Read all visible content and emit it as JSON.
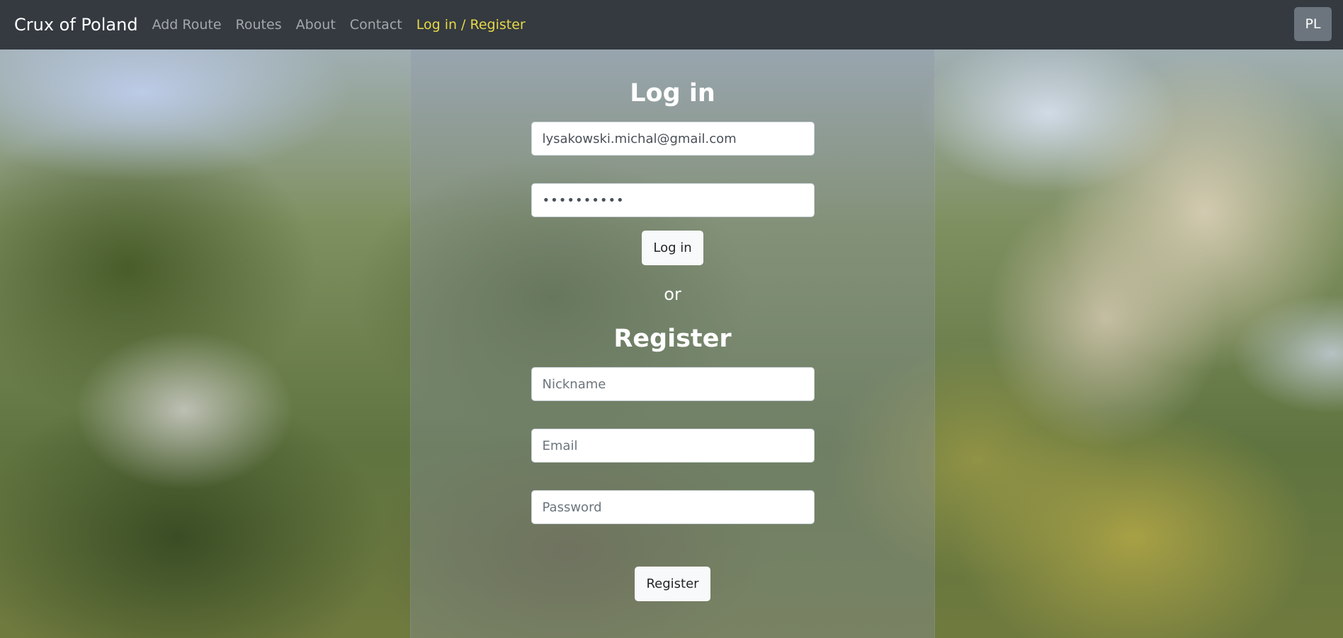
{
  "navbar": {
    "brand": "Crux of Poland",
    "links": [
      {
        "label": "Add Route"
      },
      {
        "label": "Routes"
      },
      {
        "label": "About"
      },
      {
        "label": "Contact"
      },
      {
        "label": "Log in / Register",
        "active": true
      }
    ],
    "language_button": "PL",
    "active_color": "#e8d847",
    "background_color": "#343a40"
  },
  "login": {
    "title": "Log in",
    "email_value": "lysakowski.michal@gmail.com",
    "password_value": "••••••••••",
    "submit_label": "Log in"
  },
  "separator": "or",
  "register": {
    "title": "Register",
    "nickname_placeholder": "Nickname",
    "email_placeholder": "Email",
    "password_placeholder": "Password",
    "submit_label": "Register"
  }
}
